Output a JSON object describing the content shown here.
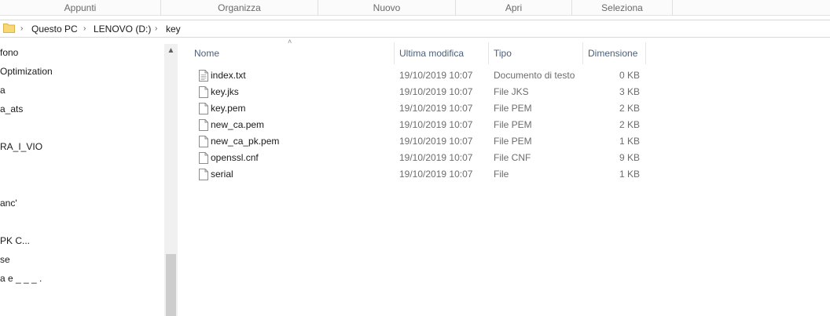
{
  "ribbon": {
    "groups": [
      "Appunti",
      "Organizza",
      "Nuovo",
      "Apri",
      "Seleziona"
    ]
  },
  "address": {
    "crumbs": [
      "Questo PC",
      "LENOVO (D:)",
      "key"
    ]
  },
  "nav": {
    "items": [
      "fono",
      "Optimization",
      "a",
      "a_ats",
      "RA_I_VIO",
      "anc'",
      "PK C...",
      "se",
      "a e _ _ _ ."
    ]
  },
  "columns": {
    "name": "Nome",
    "modified": "Ultima modifica",
    "type": "Tipo",
    "size": "Dimensione"
  },
  "files": [
    {
      "name": "index.txt",
      "modified": "19/10/2019 10:07",
      "type": "Documento di testo",
      "size": "0 KB"
    },
    {
      "name": "key.jks",
      "modified": "19/10/2019 10:07",
      "type": "File JKS",
      "size": "3 KB"
    },
    {
      "name": "key.pem",
      "modified": "19/10/2019 10:07",
      "type": "File PEM",
      "size": "2 KB"
    },
    {
      "name": "new_ca.pem",
      "modified": "19/10/2019 10:07",
      "type": "File PEM",
      "size": "2 KB"
    },
    {
      "name": "new_ca_pk.pem",
      "modified": "19/10/2019 10:07",
      "type": "File PEM",
      "size": "1 KB"
    },
    {
      "name": "openssl.cnf",
      "modified": "19/10/2019 10:07",
      "type": "File CNF",
      "size": "9 KB"
    },
    {
      "name": "serial",
      "modified": "19/10/2019 10:07",
      "type": "File",
      "size": "1 KB"
    }
  ]
}
